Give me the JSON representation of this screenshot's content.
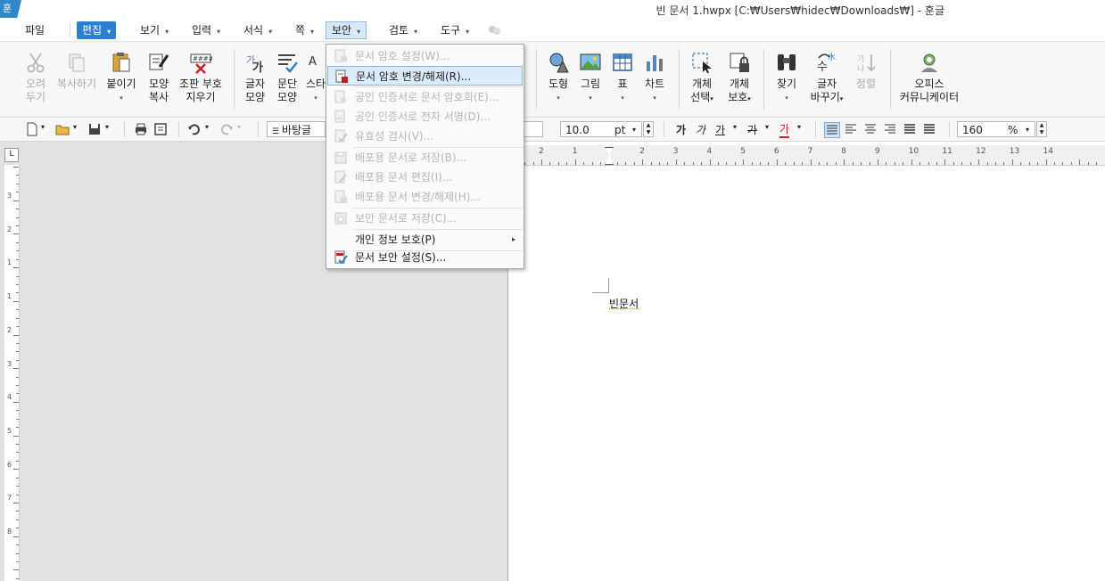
{
  "window": {
    "title": "빈 문서 1.hwpx [C:₩Users₩hidec₩Downloads₩] - 훈글",
    "logo_glyph": "훈"
  },
  "menubar": {
    "items": [
      {
        "label": "파일"
      },
      {
        "label": "편집"
      },
      {
        "label": "보기"
      },
      {
        "label": "입력"
      },
      {
        "label": "서식"
      },
      {
        "label": "쪽"
      },
      {
        "label": "보안"
      },
      {
        "label": "검토"
      },
      {
        "label": "도구"
      }
    ],
    "dropdown_arrow": "▾",
    "active_color": "#2d7fd2"
  },
  "ribbon": {
    "buttons": [
      {
        "label1": "오려",
        "label2": "두기"
      },
      {
        "label1": "복사하기",
        "label2": ""
      },
      {
        "label1": "붙이기",
        "label2": ""
      },
      {
        "label1": "모양",
        "label2": "복사"
      },
      {
        "label1": "조판 부호",
        "label2": "지우기"
      },
      {
        "label1": "글자",
        "label2": "모양"
      },
      {
        "label1": "문단",
        "label2": "모양"
      },
      {
        "label1": "스타",
        "label2": ""
      },
      {
        "label1": "도형",
        "label2": ""
      },
      {
        "label1": "그림",
        "label2": ""
      },
      {
        "label1": "표",
        "label2": ""
      },
      {
        "label1": "차트",
        "label2": ""
      },
      {
        "label1": "개체",
        "label2": "선택"
      },
      {
        "label1": "개체",
        "label2": "보호"
      },
      {
        "label1": "찾기",
        "label2": ""
      },
      {
        "label1": "글자",
        "label2": "바꾸기"
      },
      {
        "label1": "정렬",
        "label2": ""
      },
      {
        "label1": "오피스",
        "label2": "커뮤니케이터"
      }
    ]
  },
  "toolbar": {
    "style_value": "바탕글",
    "font_size_value": "10.0",
    "font_size_unit": "pt",
    "zoom_value": "160",
    "zoom_unit": "%",
    "char_buttons": [
      "가",
      "가",
      "가",
      "가",
      "가"
    ]
  },
  "ruler": {
    "h_labels": [
      "2",
      "1",
      "1",
      "2",
      "3",
      "4",
      "5",
      "6",
      "7",
      "8",
      "9",
      "10",
      "11",
      "12",
      "13",
      "14"
    ],
    "v_labels": [
      "3",
      "2",
      "1",
      "1",
      "2",
      "3",
      "4",
      "5",
      "6",
      "7",
      "8"
    ],
    "corner_glyph": "L"
  },
  "document": {
    "text": "빈문서"
  },
  "security_menu": {
    "items": [
      {
        "label": "문서 암호 설정(W)...",
        "disabled": true
      },
      {
        "label": "문서 암호 변경/해제(R)...",
        "disabled": false,
        "hover": true
      },
      {
        "label": "공인 인증서로 문서 암호화(E)...",
        "disabled": true
      },
      {
        "label": "공인 인증서로 전자 서명(D)...",
        "disabled": true
      },
      {
        "label": "유효성 검사(V)...",
        "disabled": true
      },
      {
        "label": "배포용 문서로 저장(B)...",
        "disabled": true
      },
      {
        "label": "배포용 문서 편집(I)...",
        "disabled": true
      },
      {
        "label": "배포용 문서 변경/해제(H)...",
        "disabled": true
      },
      {
        "label": "보안 문서로 저장(C)...",
        "disabled": true
      },
      {
        "label": "개인 정보 보호(P)",
        "disabled": false,
        "has_submenu": true
      },
      {
        "label": "문서 보안 설정(S)...",
        "disabled": false
      }
    ],
    "submenu_arrow": "▸"
  }
}
